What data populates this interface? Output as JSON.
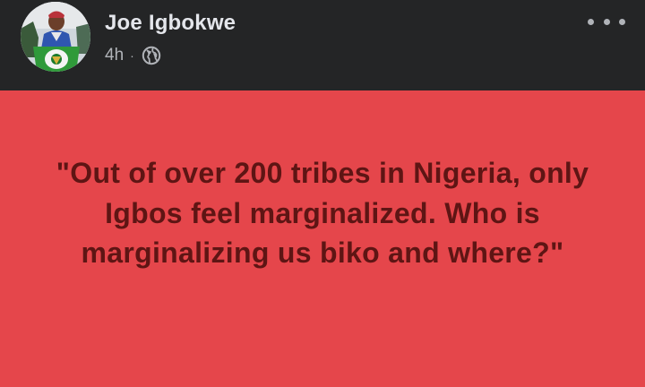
{
  "post": {
    "author": "Joe Igbokwe",
    "time": "4h",
    "separator": "·",
    "audience_icon": "globe-icon",
    "menu_icon": "more-options-icon",
    "avatar_icon": "profile-photo",
    "quote": "\"Out of over 200 tribes in Nigeria, only Igbos feel marginalized. Who is marginalizing us biko and where?\""
  },
  "colors": {
    "header_bg": "#242526",
    "name_text": "#e4e6eb",
    "meta_text": "#b0b3b8",
    "post_bg": "#e5464b",
    "quote_text": "#5e1514"
  }
}
